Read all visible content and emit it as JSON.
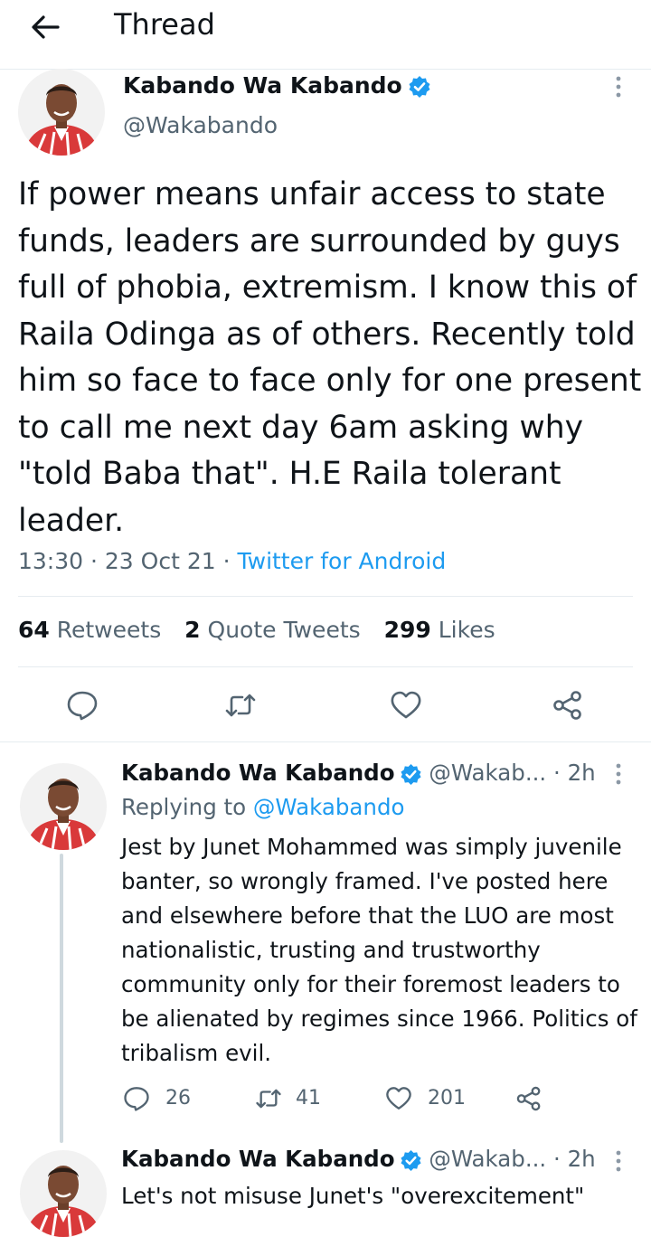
{
  "header": {
    "title": "Thread"
  },
  "main_tweet": {
    "author_name": "Kabando Wa Kabando",
    "handle": "@Wakabando",
    "text": "If power means unfair access to state funds, leaders are surrounded by guys full of phobia, extremism. I know this of Raila Odinga as of others. Recently told him so face to face only for one present to call me next day 6am asking why \"told Baba that\". H.E Raila tolerant leader.",
    "time": "13:30",
    "date": "23 Oct 21",
    "source": "Twitter for Android",
    "retweets_count": "64",
    "retweets_label": "Retweets",
    "quotes_count": "2",
    "quotes_label": "Quote Tweets",
    "likes_count": "299",
    "likes_label": "Likes"
  },
  "replies": [
    {
      "author_name": "Kabando Wa Kabando",
      "handle": "@Wakab...",
      "time": "· 2h",
      "replying_prefix": "Replying to",
      "replying_handle": "@Wakabando",
      "text": "Jest by Junet Mohammed was simply juvenile banter, so wrongly framed. I've posted here and elsewhere before that the LUO are most nationalistic, trusting and trustworthy community only for their foremost leaders to be alienated by regimes since 1966. Politics of tribalism evil.",
      "reply_count": "26",
      "retweet_count": "41",
      "like_count": "201"
    },
    {
      "author_name": "Kabando Wa Kabando",
      "handle": "@Wakab...",
      "time": "· 2h",
      "text": "Let's not misuse Junet's \"overexcitement\""
    }
  ],
  "colors": {
    "accent": "#1d9bf0",
    "secondary_text": "#536471",
    "primary_text": "#0f1419",
    "divider": "#e6ecf0"
  },
  "icons": [
    "back-arrow-icon",
    "verified-badge-icon",
    "more-icon",
    "reply-icon",
    "retweet-icon",
    "like-icon",
    "share-icon"
  ]
}
